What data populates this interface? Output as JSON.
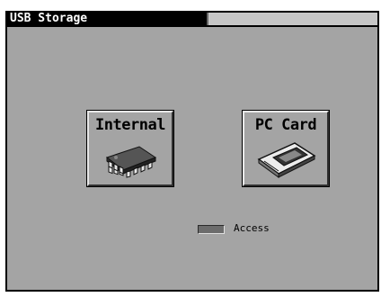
{
  "window": {
    "title": "USB Storage"
  },
  "buttons": {
    "internal": {
      "label": "Internal",
      "icon": "memory-chip-icon"
    },
    "pc_card": {
      "label": "PC Card",
      "icon": "pc-card-icon"
    }
  },
  "indicator": {
    "access_label": "Access",
    "state": "off"
  },
  "colors": {
    "background": "#a4a4a4",
    "title_bar": "#000000",
    "title_text": "#ffffff"
  }
}
